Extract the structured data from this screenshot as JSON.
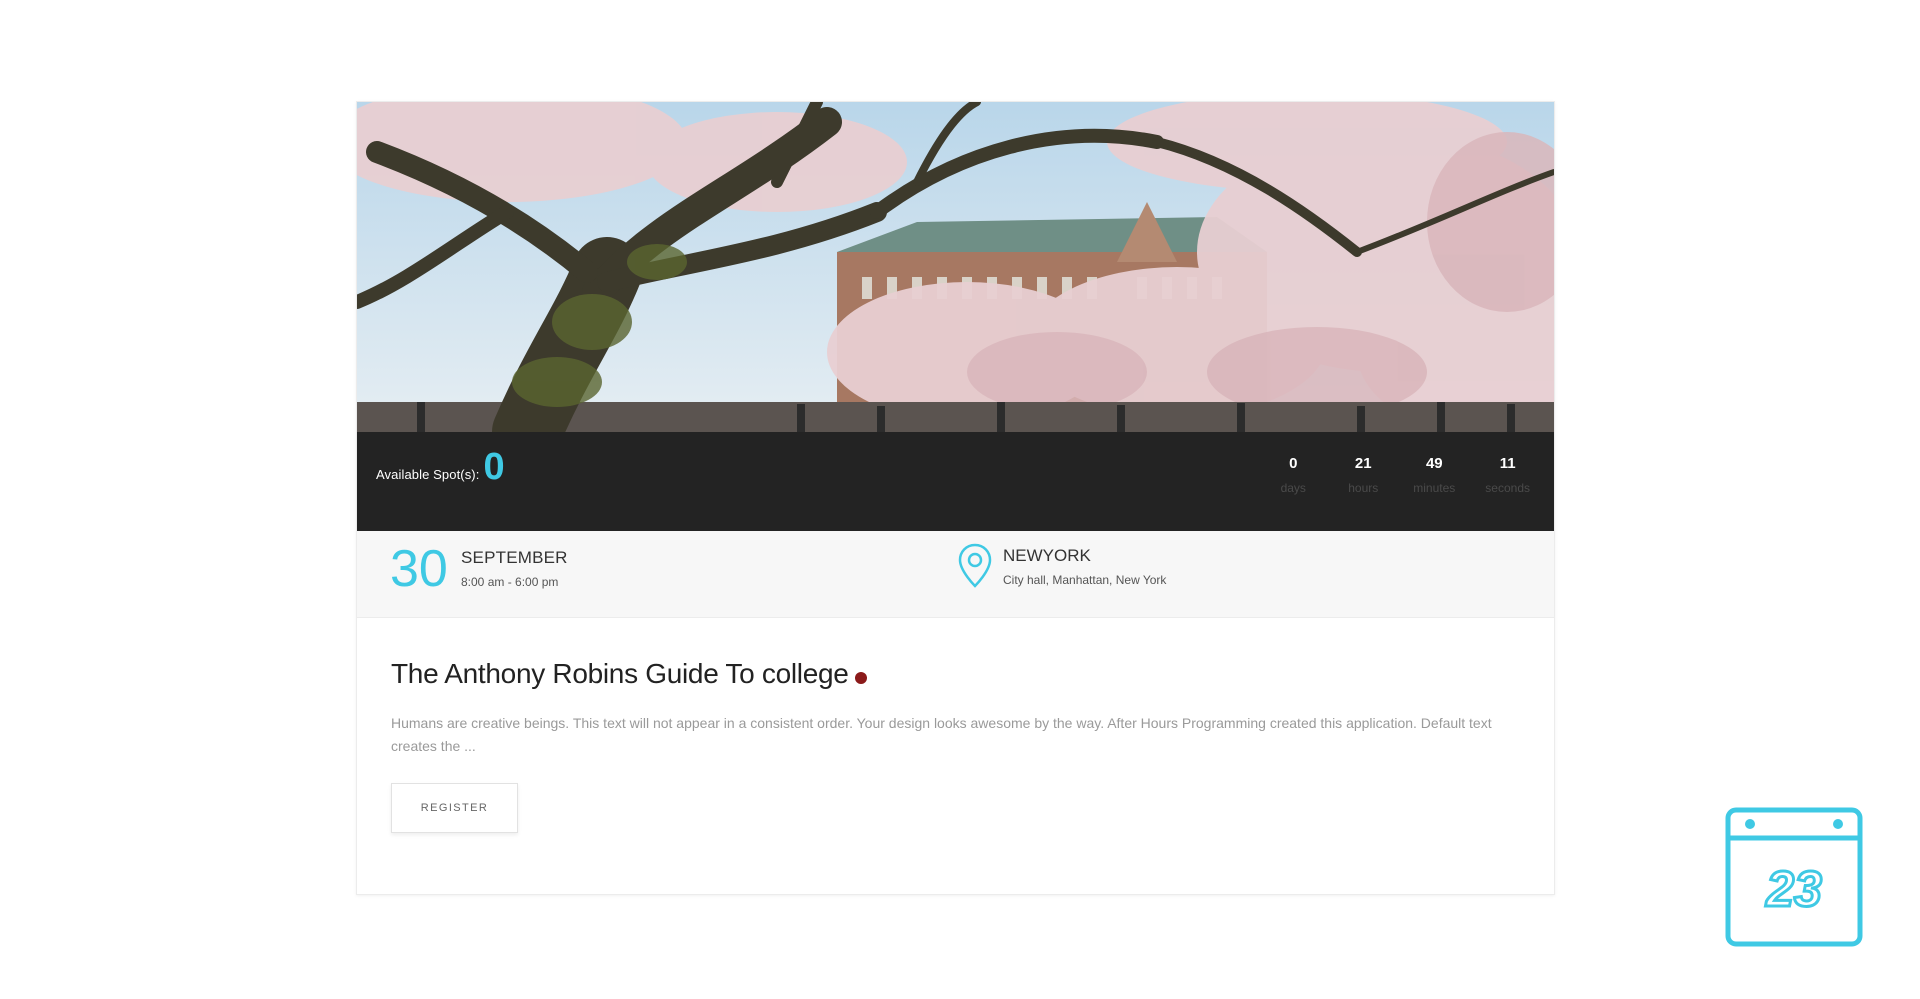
{
  "event": {
    "availability": {
      "label": "Available Spot(s):",
      "count": "0"
    },
    "countdown": [
      {
        "value": "0",
        "label": "days"
      },
      {
        "value": "21",
        "label": "hours"
      },
      {
        "value": "49",
        "label": "minutes"
      },
      {
        "value": "11",
        "label": "seconds"
      }
    ],
    "date": {
      "day": "30",
      "month": "SEPTEMBER",
      "time": "8:00 am - 6:00 pm"
    },
    "location": {
      "city": "NEWYORK",
      "address": "City hall, Manhattan, New York"
    },
    "title": "The Anthony Robins Guide To college",
    "description": "Humans are creative beings. This text will not appear in a consistent order. Your design looks awesome by the way. After Hours Programming created this application. Default text creates the ...",
    "register_label": "REGISTER"
  },
  "calendar_widget": {
    "number": "23"
  },
  "icons": {
    "location": "map-pin-icon",
    "calendar": "calendar-icon",
    "status": "status-dot"
  },
  "colors": {
    "accent": "#3fc9e4",
    "infobar_bg": "#232323",
    "status_dot": "#8b1a1a",
    "meta_bg": "#f7f7f7"
  }
}
